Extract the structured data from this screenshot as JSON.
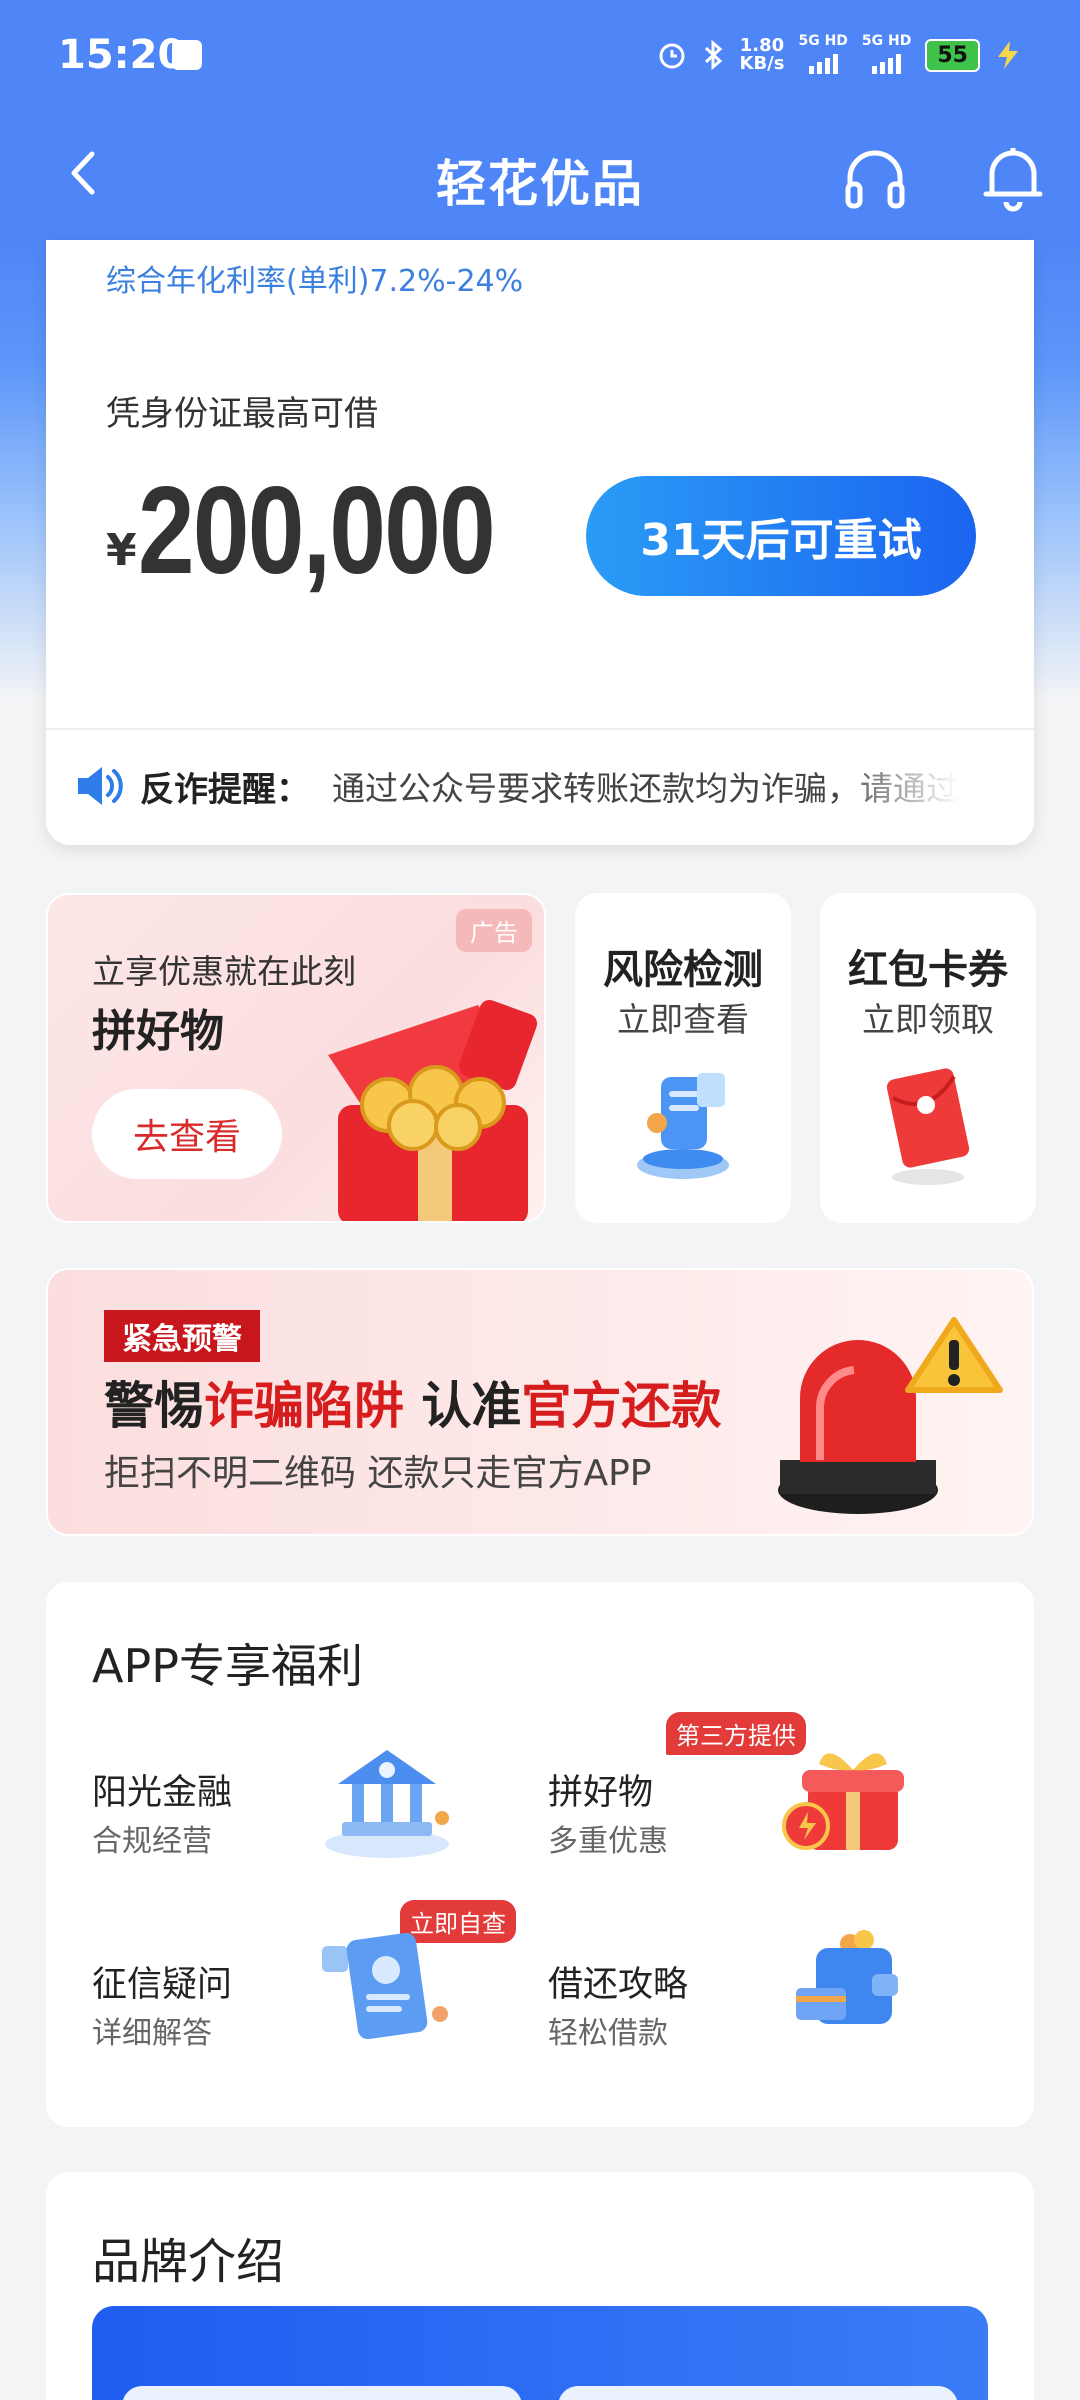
{
  "status_bar": {
    "time": "15:20",
    "net_speed_value": "1.80",
    "net_speed_unit": "KB/s",
    "signal1": "5G HD",
    "signal2": "5G HD",
    "battery": "55"
  },
  "nav": {
    "title": "轻花优品"
  },
  "loan": {
    "rate_text": "综合年化利率(单利)7.2%-24%",
    "limit_label": "凭身份证最高可借",
    "currency": "¥",
    "amount": "200,000",
    "retry_button": "31天后可重试"
  },
  "notice": {
    "label": "反诈提醒：",
    "text": "通过公众号要求转账还款均为诈骗，请通过"
  },
  "promo": {
    "ad_tag": "广告",
    "subtitle": "立享优惠就在此刻",
    "title": "拼好物",
    "button": "去查看",
    "risk_title": "风险检测",
    "risk_sub": "立即查看",
    "coupon_title": "红包卡券",
    "coupon_sub": "立即领取"
  },
  "warning": {
    "tag": "紧急预警",
    "title_a": "警惕",
    "title_b": "诈骗陷阱",
    "title_c": " 认准",
    "title_d": "官方还款",
    "subtitle": "拒扫不明二维码 还款只走官方APP"
  },
  "benefits": {
    "title": "APP专享福利",
    "items": [
      {
        "title": "阳光金融",
        "sub": "合规经营",
        "icon": "bank-icon"
      },
      {
        "title": "拼好物",
        "sub": "多重优惠",
        "badge": "第三方提供",
        "icon": "gift-box-icon"
      },
      {
        "title": "征信疑问",
        "sub": "详细解答",
        "badge": "立即自查",
        "icon": "credit-report-icon"
      },
      {
        "title": "借还攻略",
        "sub": "轻松借款",
        "icon": "wallet-icon"
      }
    ]
  },
  "brand": {
    "title": "品牌介绍"
  },
  "colors": {
    "primary_blue": "#4f86f7",
    "button_blue": "#1b64f0",
    "alert_red": "#d61c1c"
  }
}
